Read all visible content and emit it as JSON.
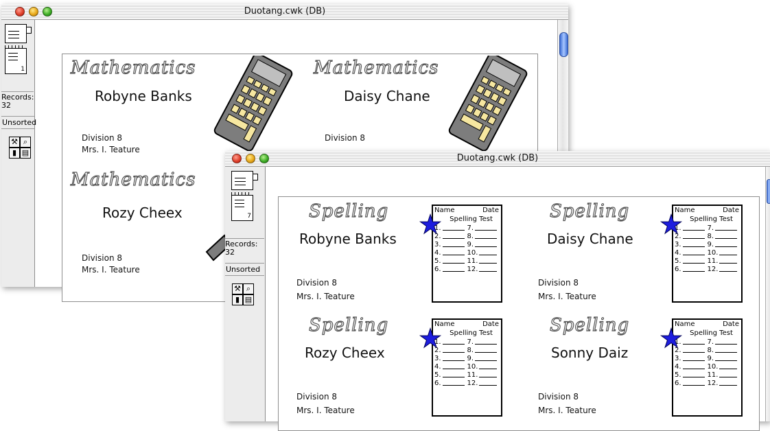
{
  "back_window": {
    "title": "Duotang.cwk (DB)",
    "record_number": "1",
    "records_label": "Records:",
    "records_count": "32",
    "sort_status": "Unsorted",
    "labels": [
      {
        "subject": "Mathematics",
        "student": "Robyne Banks",
        "division": "Division 8",
        "teacher": "Mrs. I. Teature"
      },
      {
        "subject": "Mathematics",
        "student": "Daisy Chane",
        "division": "Division 8",
        "teacher": ""
      },
      {
        "subject": "Mathematics",
        "student": "Rozy Cheex",
        "division": "Division 8",
        "teacher": "Mrs. I. Teature"
      }
    ]
  },
  "front_window": {
    "title": "Duotang.cwk (DB)",
    "record_number": "7",
    "records_label": "Records:",
    "records_count": "32",
    "sort_status": "Unsorted",
    "labels": [
      {
        "subject": "Spelling",
        "student": "Robyne Banks",
        "division": "Division 8",
        "teacher": "Mrs. I. Teature"
      },
      {
        "subject": "Spelling",
        "student": "Daisy Chane",
        "division": "Division 8",
        "teacher": "Mrs. I. Teature"
      },
      {
        "subject": "Spelling",
        "student": "Rozy Cheex",
        "division": "Division 8",
        "teacher": "Mrs. I. Teature"
      },
      {
        "subject": "Spelling",
        "student": "Sonny Daiz",
        "division": "Division 8",
        "teacher": "Mrs. I. Teature"
      }
    ],
    "test_card": {
      "name_label": "Name",
      "date_label": "Date",
      "title": "Spelling Test",
      "left_numbers": [
        "1.",
        "2.",
        "3.",
        "4.",
        "5.",
        "6."
      ],
      "right_numbers": [
        "7.",
        "8.",
        "9.",
        "10.",
        "11.",
        "12."
      ]
    }
  },
  "icons": {
    "tool_layout": "layout-tool-icon",
    "tool_find": "magnifier-icon",
    "tool_chart": "chart-icon",
    "tool_copy": "pages-icon"
  },
  "colors": {
    "star": "#1d1dde",
    "calculator_body": "#808080",
    "calculator_keys": "#f6e7a0",
    "close": "#e0412c",
    "minimize": "#e9a91b",
    "zoom": "#3fae27"
  }
}
